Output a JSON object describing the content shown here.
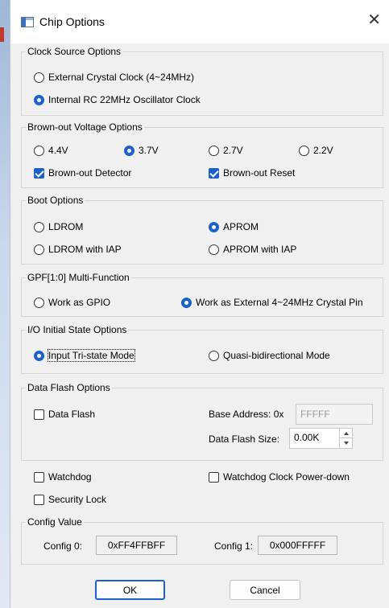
{
  "window": {
    "title": "Chip Options",
    "close_glyph": "✕"
  },
  "clock": {
    "legend": "Clock Source Options",
    "external": "External Crystal Clock (4~24MHz)",
    "internal": "Internal RC 22MHz Oscillator Clock",
    "selected": "internal"
  },
  "brownout": {
    "legend": "Brown-out Voltage Options",
    "voltages": [
      "4.4V",
      "3.7V",
      "2.7V",
      "2.2V"
    ],
    "selected_voltage": "3.7V",
    "detector": "Brown-out Detector",
    "reset": "Brown-out Reset",
    "detector_checked": true,
    "reset_checked": true
  },
  "boot": {
    "legend": "Boot Options",
    "ldrom": "LDROM",
    "aprom": "APROM",
    "ldrom_iap": "LDROM with IAP",
    "aprom_iap": "APROM with IAP",
    "selected": "APROM"
  },
  "gpf": {
    "legend": "GPF[1:0] Multi-Function",
    "gpio": "Work as GPIO",
    "crystal": "Work as External 4~24MHz Crystal Pin",
    "selected": "crystal"
  },
  "io": {
    "legend": "I/O Initial State Options",
    "tristate": "Input Tri-state Mode",
    "quasi": "Quasi-bidirectional Mode",
    "selected": "tristate"
  },
  "dataflash": {
    "legend": "Data Flash Options",
    "checkbox": "Data Flash",
    "checked": false,
    "base_label": "Base Address: 0x",
    "base_value": "FFFFF",
    "size_label": "Data Flash Size:",
    "size_value": "0.00K"
  },
  "misc": {
    "watchdog": "Watchdog",
    "watchdog_pd": "Watchdog Clock Power-down",
    "security": "Security Lock",
    "watchdog_checked": false,
    "watchdog_pd_checked": false,
    "security_checked": false
  },
  "config": {
    "legend": "Config Value",
    "config0_label": "Config 0:",
    "config0_value": "0xFF4FFBFF",
    "config1_label": "Config 1:",
    "config1_value": "0x000FFFFF"
  },
  "buttons": {
    "ok": "OK",
    "cancel": "Cancel"
  },
  "colors": {
    "accent": "#1a62c9",
    "dialog_bg": "#f0f0f0"
  }
}
